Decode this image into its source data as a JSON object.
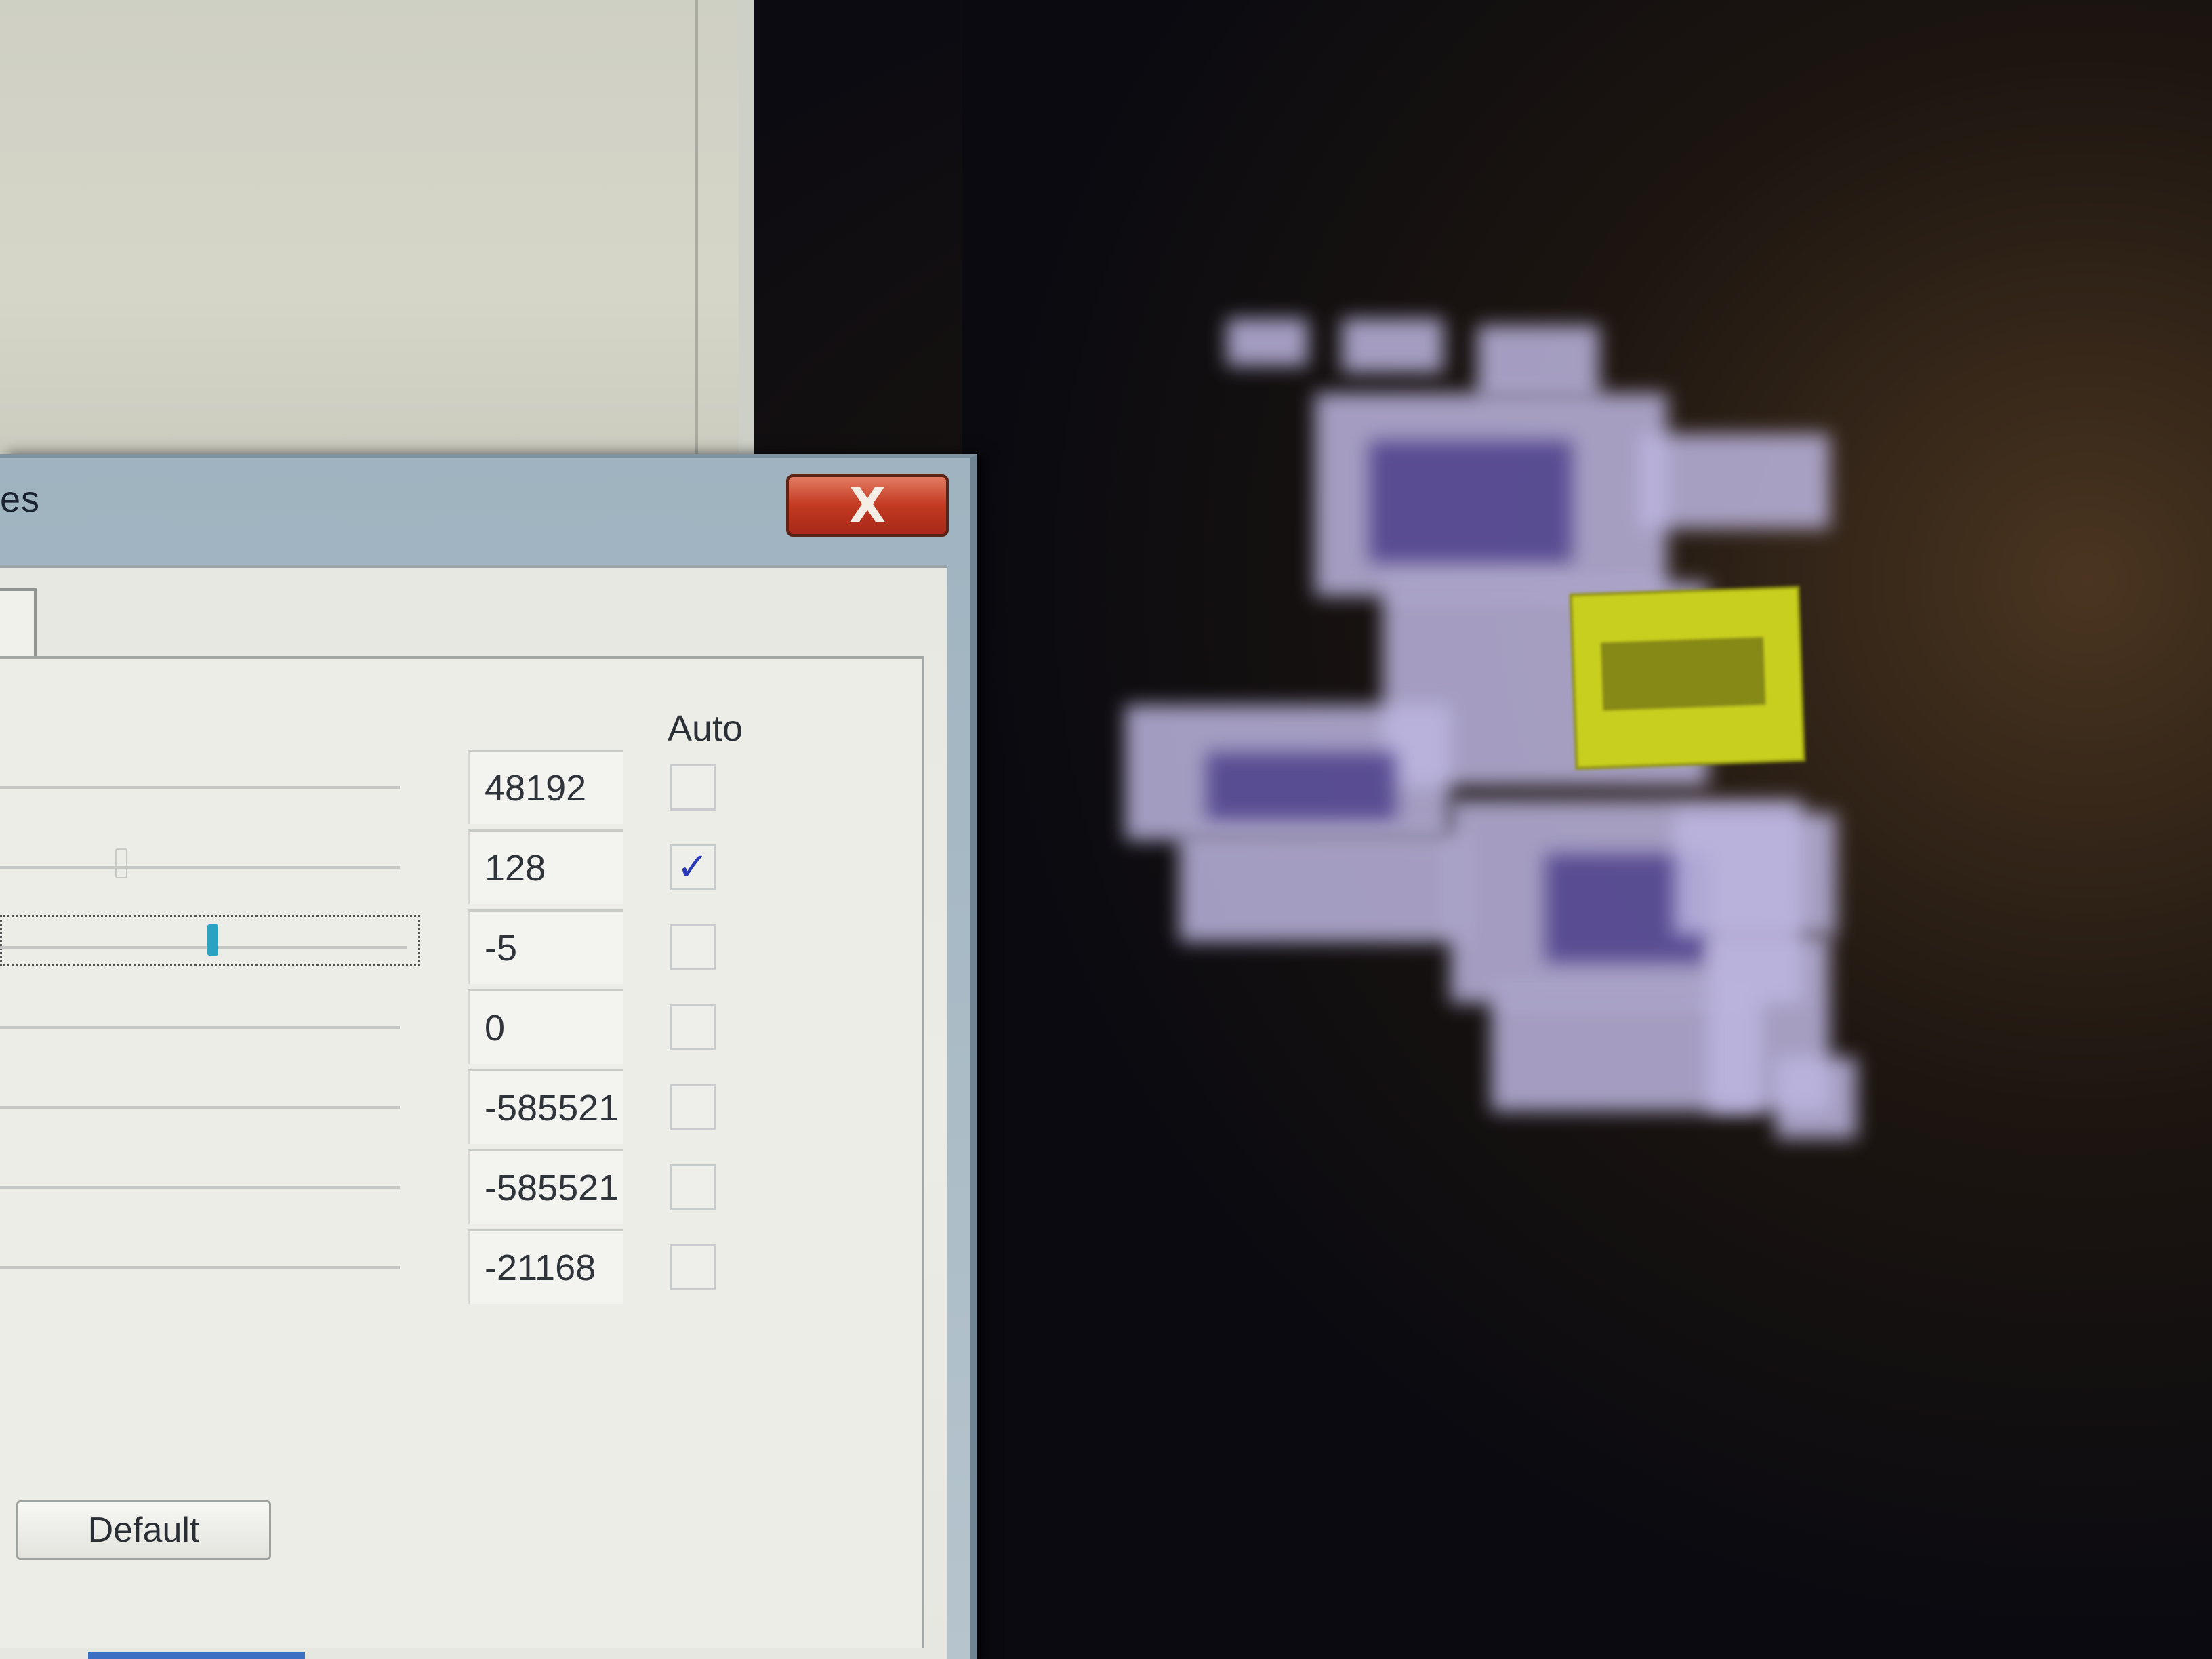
{
  "dialog": {
    "title_fragment": "es",
    "close_glyph": "X",
    "auto_header": "Auto",
    "default_button": "Default",
    "rows": [
      {
        "value": "48192",
        "auto": false
      },
      {
        "value": "128",
        "auto": true
      },
      {
        "value": "-5",
        "auto": false
      },
      {
        "value": "0",
        "auto": false
      },
      {
        "value": "-585521",
        "auto": false
      },
      {
        "value": "-585521",
        "auto": false
      },
      {
        "value": "-21168",
        "auto": false
      }
    ],
    "check_glyph": "✓"
  },
  "colors": {
    "close_button": "#c23a21",
    "slider_thumb": "#2aa2c2",
    "checkmark": "#2a39b8",
    "preview_tag": "#c9cf1e"
  }
}
